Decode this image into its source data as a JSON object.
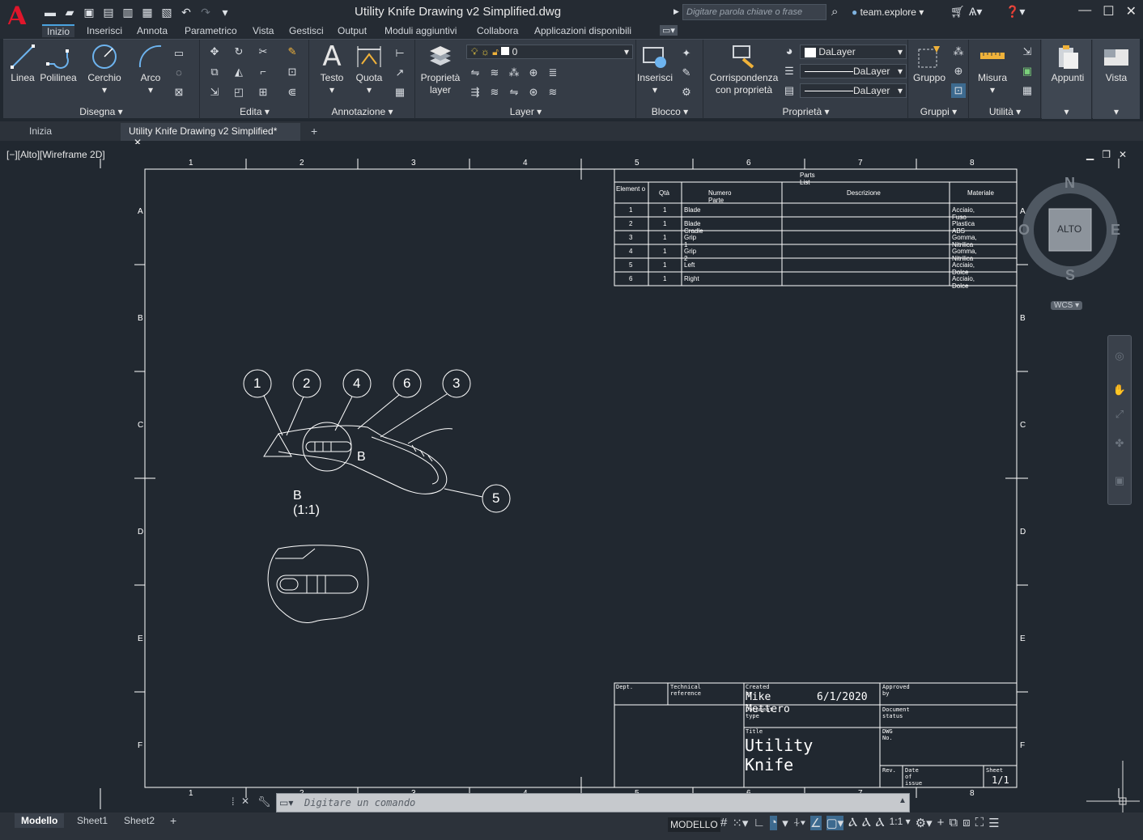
{
  "app": {
    "title": "Utility Knife Drawing v2 Simplified.dwg",
    "search_placeholder": "Digitare parola chiave o frase",
    "user": "team.explore"
  },
  "ribbon_tabs": [
    "Inizio",
    "Inserisci",
    "Annota",
    "Parametrico",
    "Vista",
    "Gestisci",
    "Output",
    "Moduli aggiuntivi",
    "Collabora",
    "Applicazioni disponibili"
  ],
  "ribbon": {
    "disegna": {
      "title": "Disegna",
      "linea": "Linea",
      "polilinea": "Polilinea",
      "cerchio": "Cerchio",
      "arco": "Arco"
    },
    "edita": {
      "title": "Edita"
    },
    "annotazione": {
      "title": "Annotazione",
      "testo": "Testo",
      "quota": "Quota"
    },
    "layer": {
      "title": "Layer",
      "proprieta_layer_1": "Proprietà",
      "proprieta_layer_2": "layer",
      "current_layer": "0"
    },
    "blocco": {
      "title": "Blocco",
      "inserisci": "Inserisci"
    },
    "proprieta": {
      "title": "Proprietà",
      "corrispondenza_1": "Corrispondenza",
      "corrispondenza_2": "con proprietà",
      "color": "DaLayer",
      "linetype": "DaLayer",
      "lineweight": "DaLayer"
    },
    "gruppi": {
      "title": "Gruppi",
      "gruppo": "Gruppo"
    },
    "utilita": {
      "title": "Utilità",
      "misura": "Misura"
    },
    "appunti": {
      "title": "Appunti"
    },
    "vista": {
      "title": "Vista"
    }
  },
  "file_tabs": [
    "Inizia",
    "Utility Knife Drawing v2 Simplified*"
  ],
  "viewport": {
    "label": "[−][Alto][Wireframe 2D]"
  },
  "viewcube": {
    "n": "N",
    "s": "S",
    "e": "E",
    "w": "O",
    "face": "ALTO",
    "wcs": "WCS"
  },
  "drawing": {
    "col_labels": [
      "1",
      "2",
      "3",
      "4",
      "5",
      "6",
      "7",
      "8"
    ],
    "row_labels": [
      "A",
      "B",
      "C",
      "D",
      "E",
      "F"
    ],
    "parts_list": {
      "title": "Parts List",
      "headers": [
        "Element o",
        "Qtà",
        "Numero Parte",
        "Descrizione",
        "Materiale"
      ],
      "rows": [
        [
          "1",
          "1",
          "Blade",
          "",
          "Acciaio, Fuso"
        ],
        [
          "2",
          "1",
          "Blade Cradle",
          "",
          "Plastica ABS"
        ],
        [
          "3",
          "1",
          "Grip 1",
          "",
          "Gomma, Nitrilica"
        ],
        [
          "4",
          "1",
          "Grip 2",
          "",
          "Gomma, Nitrilica"
        ],
        [
          "5",
          "1",
          "Left",
          "",
          "Acciaio, Dolce"
        ],
        [
          "6",
          "1",
          "Right",
          "",
          "Acciaio, Dolce"
        ]
      ]
    },
    "balloons": [
      "1",
      "2",
      "4",
      "6",
      "3",
      "5"
    ],
    "detail_label": "B (1:1)",
    "detail_letter": "B",
    "title_block": {
      "dept": "Dept.",
      "tech_ref": "Technical reference",
      "created_by_label": "Created by",
      "created_by": "Mike Mettero",
      "created_date": "6/1/2020",
      "approved_by": "Approved by",
      "document_type": "Document type",
      "document_status": "Document status",
      "title_label": "Title",
      "title": "Utility Knife",
      "dwg_no": "DWG No.",
      "rev": "Rev.",
      "date_of_issue": "Date of issue",
      "sheet_label": "Sheet",
      "sheet": "1/1"
    }
  },
  "command": {
    "placeholder": "Digitare un comando"
  },
  "layout_tabs": [
    "Modello",
    "Sheet1",
    "Sheet2"
  ],
  "status": {
    "mode": "MODELLO",
    "scale": "1:1"
  }
}
